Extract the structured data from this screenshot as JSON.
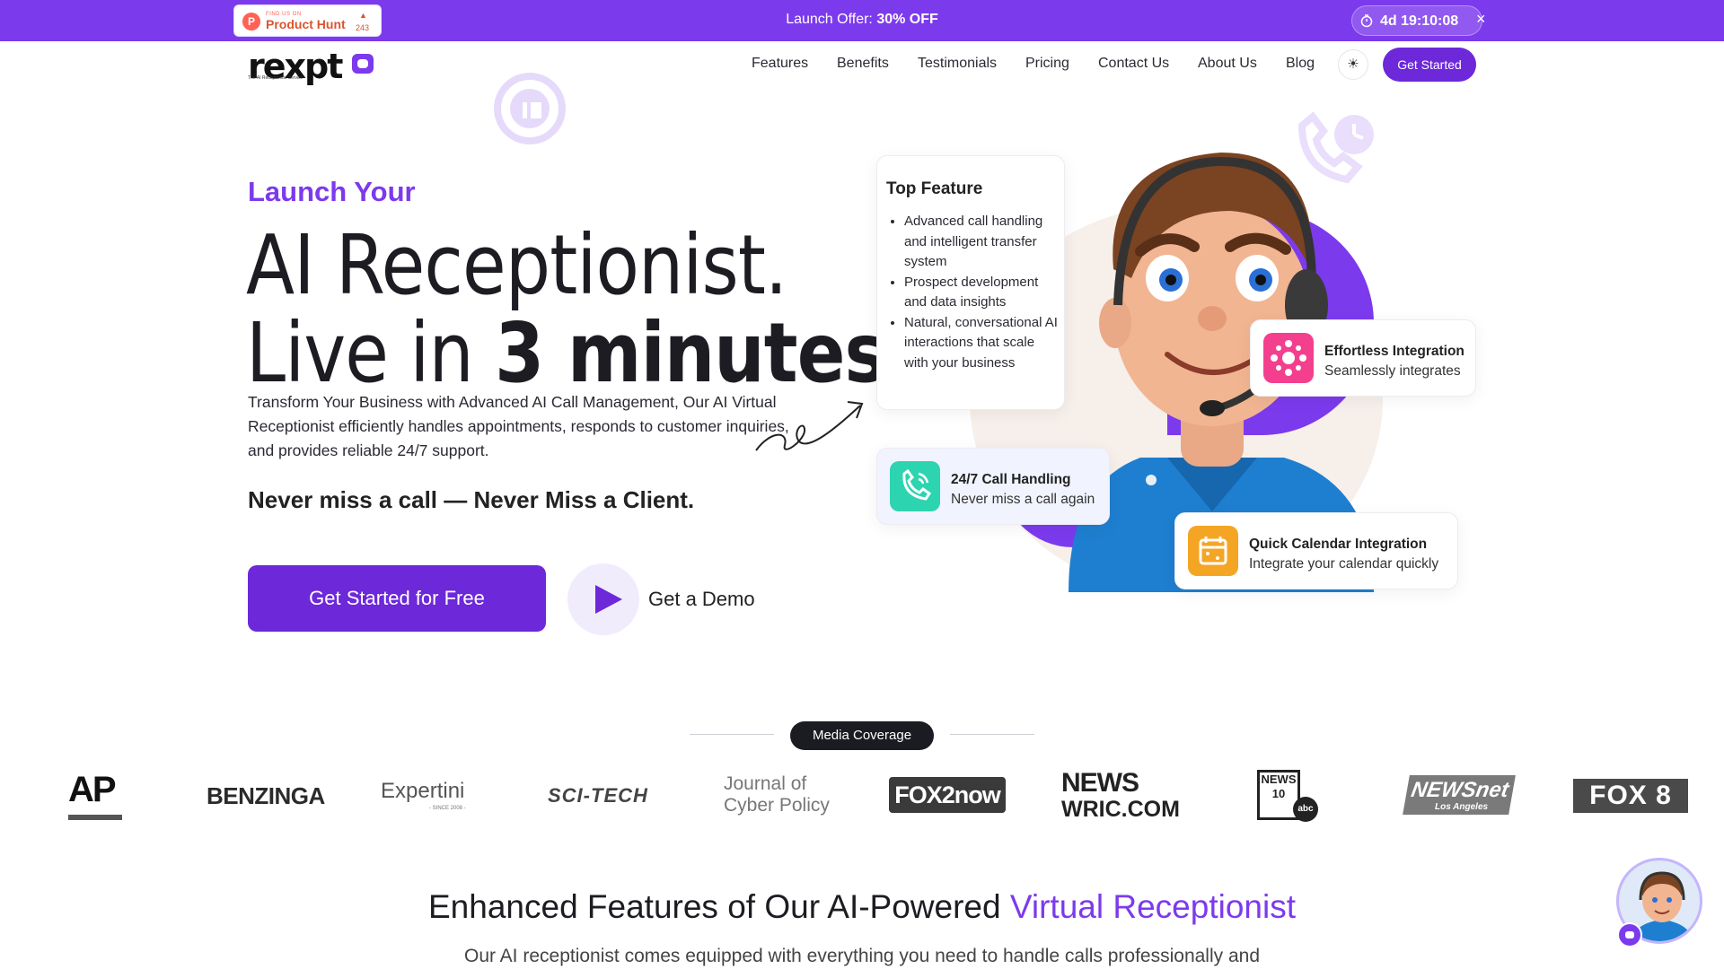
{
  "promo": {
    "product_hunt_small": "FIND US ON",
    "product_hunt_name": "Product Hunt",
    "product_hunt_count": "243",
    "offer_prefix": "Launch Offer: ",
    "offer_value": "30% OFF",
    "countdown": "4d 19:10:08",
    "close": "×"
  },
  "nav": {
    "logo": "rexpt",
    "logo_tagline": "The AI Receptionist Service",
    "items": [
      "Features",
      "Benefits",
      "Testimonials",
      "Pricing",
      "Contact Us",
      "About Us",
      "Blog"
    ],
    "cta": "Get Started"
  },
  "hero": {
    "eyebrow": "Launch Your",
    "line1": "AI Receptionist.",
    "line2_pre": "Live in ",
    "line2_bold": "3 minutes",
    "line2_post": ".",
    "description": "Transform Your Business with Advanced AI Call Management, Our AI Virtual Receptionist efficiently handles appointments, responds to customer inquiries, and provides reliable 24/7 support.",
    "tagline": "Never miss a call — Never Miss a Client.",
    "cta_primary": "Get Started for Free",
    "cta_demo": "Get a Demo"
  },
  "top_feature": {
    "title": "Top Feature",
    "items": [
      "Advanced call handling and intelligent transfer system",
      "Prospect development and data insights",
      "Natural, conversational AI interactions that scale with your business"
    ]
  },
  "feature_cards": [
    {
      "title": "Effortless Integration",
      "subtitle": "Seamlessly integrates",
      "icon": "network-icon",
      "color": "#f43f8e"
    },
    {
      "title": "24/7 Call Handling",
      "subtitle": "Never miss a call again",
      "icon": "phone-icon",
      "color": "#2dd4b0"
    },
    {
      "title": "Quick Calendar Integration",
      "subtitle": "Integrate your calendar quickly",
      "icon": "calendar-icon",
      "color": "#f5a524"
    }
  ],
  "media": {
    "label": "Media Coverage",
    "logos": {
      "ap": "AP",
      "benzinga": "BENZINGA",
      "expertini": "Expertini",
      "expertini_sub": "- SINCE 2008 -",
      "scitech": "SCI-TECH",
      "journal": "Journal of Cyber Policy",
      "fox2": "FOX2now",
      "wric_top": "NEWS",
      "wric_bottom": "WRIC.COM",
      "news10": "NEWS 10",
      "abc": "abc",
      "newsnet": "NEWSnet",
      "newsnet_sub": "Los Angeles",
      "fox8": "FOX 8"
    }
  },
  "features_section": {
    "title_pre": "Enhanced Features of Our AI-Powered ",
    "title_highlight": "Virtual Receptionist",
    "subtitle": "Our AI receptionist comes equipped with everything you need to handle calls professionally and"
  },
  "colors": {
    "brand": "#7c3aed",
    "brand_dark": "#6d28d9"
  }
}
